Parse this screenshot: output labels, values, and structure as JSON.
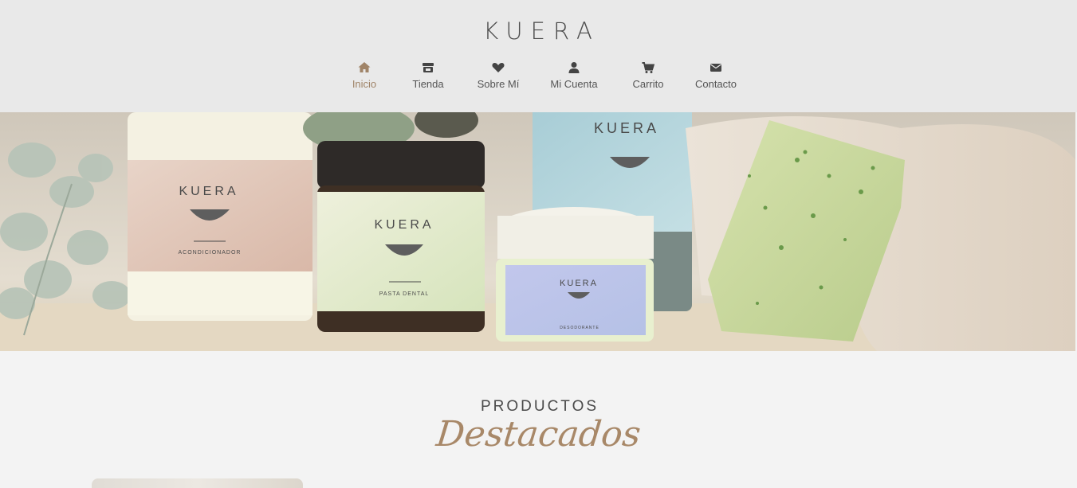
{
  "header": {
    "logo": "KUERA",
    "nav": [
      {
        "label": "Inicio",
        "icon": "home-icon",
        "active": true
      },
      {
        "label": "Tienda",
        "icon": "store-icon",
        "active": false
      },
      {
        "label": "Sobre Mí",
        "icon": "heart-icon",
        "active": false
      },
      {
        "label": "Mi Cuenta",
        "icon": "user-icon",
        "active": false
      },
      {
        "label": "Carrito",
        "icon": "cart-icon",
        "active": false
      },
      {
        "label": "Contacto",
        "icon": "envelope-icon",
        "active": false
      }
    ]
  },
  "hero": {
    "jar1": {
      "brand": "KUERA",
      "product": "ACONDICIONADOR"
    },
    "jar2": {
      "brand": "KUERA",
      "product": "PASTA DENTAL"
    },
    "jar3": {
      "brand": "KUERA"
    },
    "jar4": {
      "brand": "KUERA",
      "product": "DESODORANTE"
    }
  },
  "products": {
    "title": "PRODUCTOS",
    "subtitle": "Destacados"
  },
  "colors": {
    "header_bg": "#e9e9e9",
    "page_bg": "#f3f3f3",
    "accent": "#a08468",
    "text": "#4a4a4a"
  }
}
